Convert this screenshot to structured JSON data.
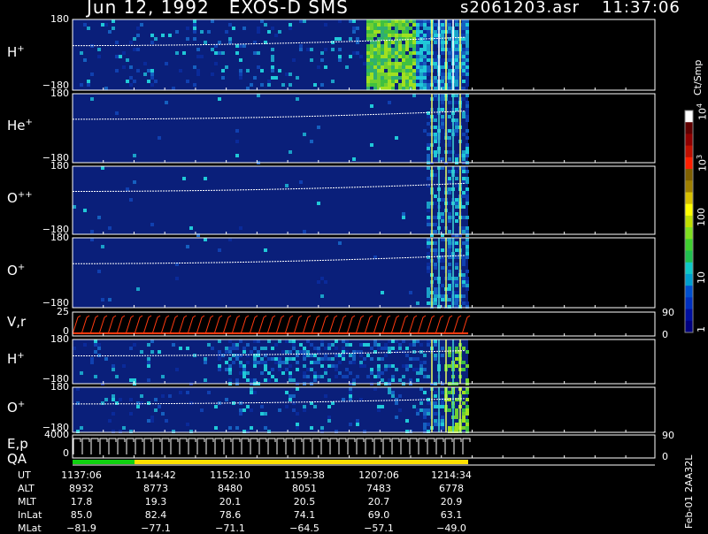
{
  "header": {
    "title": "Jun 12, 1992   EXOS-D SMS",
    "file": "s2061203.asr",
    "time": "11:37:06"
  },
  "colorbar": {
    "unit": "Ct/Smp",
    "ticks": [
      "1",
      "10",
      "100",
      "10",
      "10"
    ],
    "tick_exponents": [
      "",
      "",
      "",
      "3",
      "4"
    ]
  },
  "side_label": "Feb-01 2AA32L",
  "panels": [
    {
      "label": "H",
      "charge": "+",
      "ytop": "180",
      "ybot": "−180"
    },
    {
      "label": "He",
      "charge": "+",
      "ytop": "180",
      "ybot": "−180"
    },
    {
      "label": "O",
      "charge": "++",
      "ytop": "180",
      "ybot": "−180"
    },
    {
      "label": "O",
      "charge": "+",
      "ytop": "180",
      "ybot": "−180"
    },
    {
      "label": "V,r",
      "charge": "",
      "ytop": "25",
      "ybot": "0",
      "rtop": "90",
      "rbot": "0"
    },
    {
      "label": "H",
      "charge": "+",
      "ytop": "180",
      "ybot": "−180"
    },
    {
      "label": "O",
      "charge": "+",
      "ytop": "180",
      "ybot": "−180"
    },
    {
      "label": "E,p",
      "charge": "",
      "ytop": "4000",
      "ybot": "0",
      "rtop": "90",
      "rbot": "0"
    }
  ],
  "qa_label": "QA",
  "ephemeris": {
    "rows": [
      {
        "name": "UT",
        "values": [
          "1137:06",
          "1144:42",
          "1152:10",
          "1159:38",
          "1207:06",
          "1214:34"
        ]
      },
      {
        "name": "ALT",
        "values": [
          "8932",
          "8773",
          "8480",
          "8051",
          "7483",
          "6778"
        ]
      },
      {
        "name": "MLT",
        "values": [
          "17.8",
          "19.3",
          "20.1",
          "20.5",
          "20.7",
          "20.9"
        ]
      },
      {
        "name": "InLat",
        "values": [
          "85.0",
          "82.4",
          "78.6",
          "74.1",
          "69.0",
          "63.1"
        ]
      },
      {
        "name": "MLat",
        "values": [
          "−81.9",
          "−77.1",
          "−71.1",
          "−64.5",
          "−57.1",
          "−49.0"
        ]
      }
    ]
  },
  "chart_data": {
    "type": "heatmap",
    "title": "Jun 12, 1992   EXOS-D SMS",
    "x_ticks": [
      "1137:06",
      "1144:42",
      "1152:10",
      "1159:38",
      "1207:06",
      "1214:34"
    ],
    "panels": [
      "H+",
      "He+",
      "O++",
      "O+",
      "V,r",
      "H+",
      "O+",
      "E,p"
    ],
    "colorbar": {
      "label": "Ct/Smp",
      "scale": "log",
      "range": [
        1,
        10000
      ]
    },
    "colors": {
      "background_field": "#0a1f7a",
      "trace": "#ffffff",
      "vr_trace": "#ff3a10",
      "qa_green": "#10d010",
      "qa_yellow": "#ffe000"
    }
  }
}
